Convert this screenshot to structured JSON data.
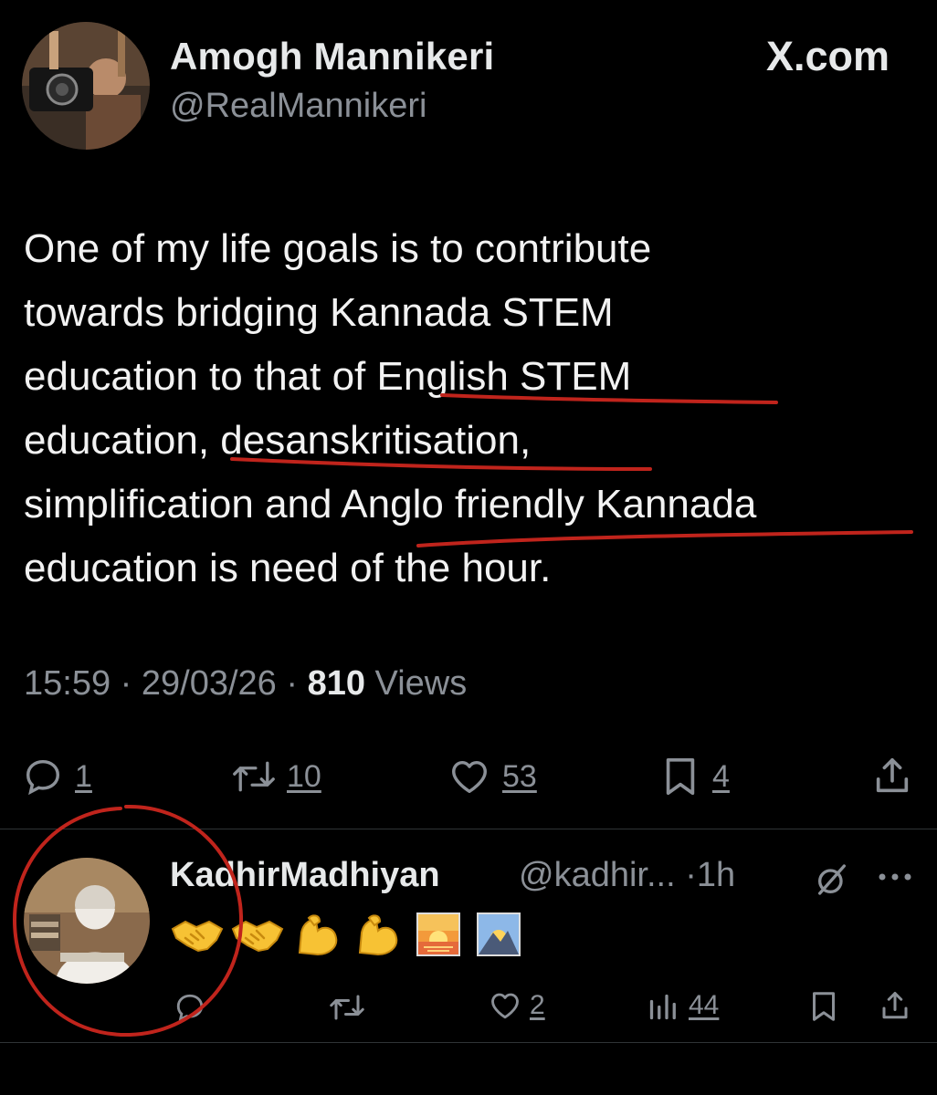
{
  "post": {
    "author_name": "Amogh Mannikeri",
    "author_handle": "@RealMannikeri",
    "site": "X.com",
    "text_lines": [
      "One of my life goals is to contribute",
      "towards bridging Kannada STEM",
      "education to that of English STEM",
      "education, desanskritisation,",
      "simplification and Anglo friendly Kannada",
      "education is need of the hour."
    ],
    "time": "15:59",
    "date": "29/03/26",
    "views_count": "810",
    "views_label": "Views",
    "separator": "·",
    "actions": {
      "replies": "1",
      "reposts": "10",
      "likes": "53",
      "bookmarks": "4"
    }
  },
  "reply": {
    "author_name": "KadhirMadhiyan",
    "author_handle": "@kadhir...",
    "time": "1h",
    "separator": "·",
    "emojis": [
      "handshake-emoji",
      "handshake-emoji",
      "flexed-biceps-emoji",
      "flexed-biceps-emoji",
      "sunrise-emoji",
      "sunrise-over-mountains-emoji"
    ],
    "actions": {
      "replies": "",
      "reposts": "",
      "likes": "2",
      "views": "44"
    }
  },
  "annotation_color": "#c0241c",
  "colors": {
    "background": "#000000",
    "text": "#e7e9ea",
    "muted": "#8b9097",
    "divider": "#2f3336"
  }
}
